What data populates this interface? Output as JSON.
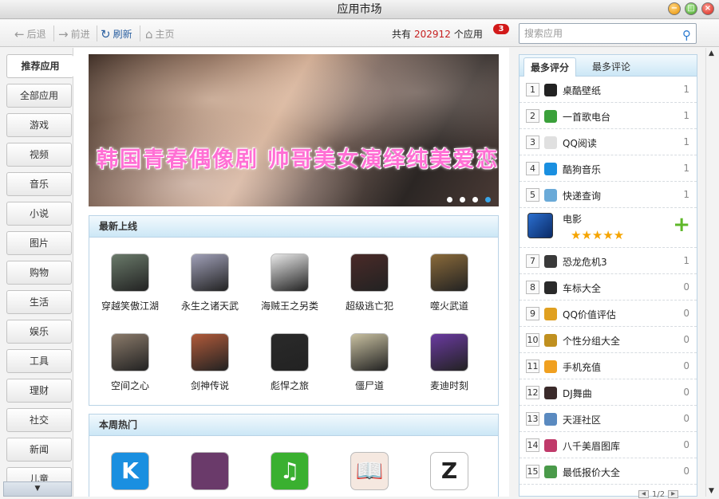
{
  "window": {
    "title": "应用市场"
  },
  "toolbar": {
    "back": "后退",
    "forward": "前进",
    "refresh": "刷新",
    "home": "主页",
    "count_prefix": "共有",
    "count_value": "202912",
    "count_suffix": "个应用",
    "badge": "3"
  },
  "search": {
    "placeholder": "搜索应用"
  },
  "sidebar": {
    "items": [
      "推荐应用",
      "全部应用",
      "游戏",
      "视频",
      "音乐",
      "小说",
      "图片",
      "购物",
      "生活",
      "娱乐",
      "工具",
      "理财",
      "社交",
      "新闻",
      "儿童"
    ],
    "active_index": 0
  },
  "banner": {
    "text": "韩国青春偶像剧 帅哥美女演绎纯美爱恋",
    "slides": 4,
    "current_slide": 4
  },
  "latest": {
    "title": "最新上线",
    "apps": [
      {
        "name": "穿越笑傲江湖",
        "color": "#6a7a6a"
      },
      {
        "name": "永生之诸天武",
        "color": "#a0a0b8"
      },
      {
        "name": "海贼王之另类",
        "color": "#e8e8e8"
      },
      {
        "name": "超级逃亡犯",
        "color": "#4a2a28"
      },
      {
        "name": "噬火武道",
        "color": "#8a6a3a"
      },
      {
        "name": "空间之心",
        "color": "#8a7a6a"
      },
      {
        "name": "剑神传说",
        "color": "#b05a3a"
      },
      {
        "name": "彪悍之旅",
        "color": "#2a2a2a"
      },
      {
        "name": "僵尸道",
        "color": "#c8c0a0"
      },
      {
        "name": "麦迪时刻",
        "color": "#6a3aa0"
      }
    ]
  },
  "weekly": {
    "title": "本周热门",
    "apps": [
      {
        "color": "#1a8fe0",
        "glyph": "K"
      },
      {
        "color": "#6a3a6a",
        "glyph": ""
      },
      {
        "color": "#3ab030",
        "glyph": "♫"
      },
      {
        "color": "#f5e8e0",
        "glyph": "📖"
      },
      {
        "color": "#ffffff",
        "glyph": "Z"
      }
    ]
  },
  "ranking": {
    "tabs": [
      "最多评分",
      "最多评论"
    ],
    "rows_top": [
      {
        "num": "1",
        "name": "桌酷壁纸",
        "score": "1",
        "icon_color": "#222222"
      },
      {
        "num": "2",
        "name": "一首歌电台",
        "score": "1",
        "icon_color": "#3aa03a"
      },
      {
        "num": "3",
        "name": "QQ阅读",
        "score": "1",
        "icon_color": "#e0e0e0"
      },
      {
        "num": "4",
        "name": "酷狗音乐",
        "score": "1",
        "icon_color": "#1a8fe0"
      },
      {
        "num": "5",
        "name": "快递查询",
        "score": "1",
        "icon_color": "#6aaad8"
      }
    ],
    "featured": {
      "name": "电影",
      "stars": "★★★★★",
      "add": "+"
    },
    "rows_bottom": [
      {
        "num": "7",
        "name": "恐龙危机3",
        "score": "1",
        "icon_color": "#3a3a3a"
      },
      {
        "num": "8",
        "name": "车标大全",
        "score": "0",
        "icon_color": "#2a2a2a"
      },
      {
        "num": "9",
        "name": "QQ价值评估",
        "score": "0",
        "icon_color": "#e0a020"
      },
      {
        "num": "10",
        "name": "个性分组大全",
        "score": "0",
        "icon_color": "#c09020"
      },
      {
        "num": "11",
        "name": "手机充值",
        "score": "0",
        "icon_color": "#f0a020"
      },
      {
        "num": "12",
        "name": "DJ舞曲",
        "score": "0",
        "icon_color": "#3a2a2a"
      },
      {
        "num": "13",
        "name": "天涯社区",
        "score": "0",
        "icon_color": "#5a8ac0"
      },
      {
        "num": "14",
        "name": "八千美眉图库",
        "score": "0",
        "icon_color": "#c03a6a"
      },
      {
        "num": "15",
        "name": "最低报价大全",
        "score": "0",
        "icon_color": "#4a9a4a"
      }
    ],
    "pager": "1/2"
  }
}
